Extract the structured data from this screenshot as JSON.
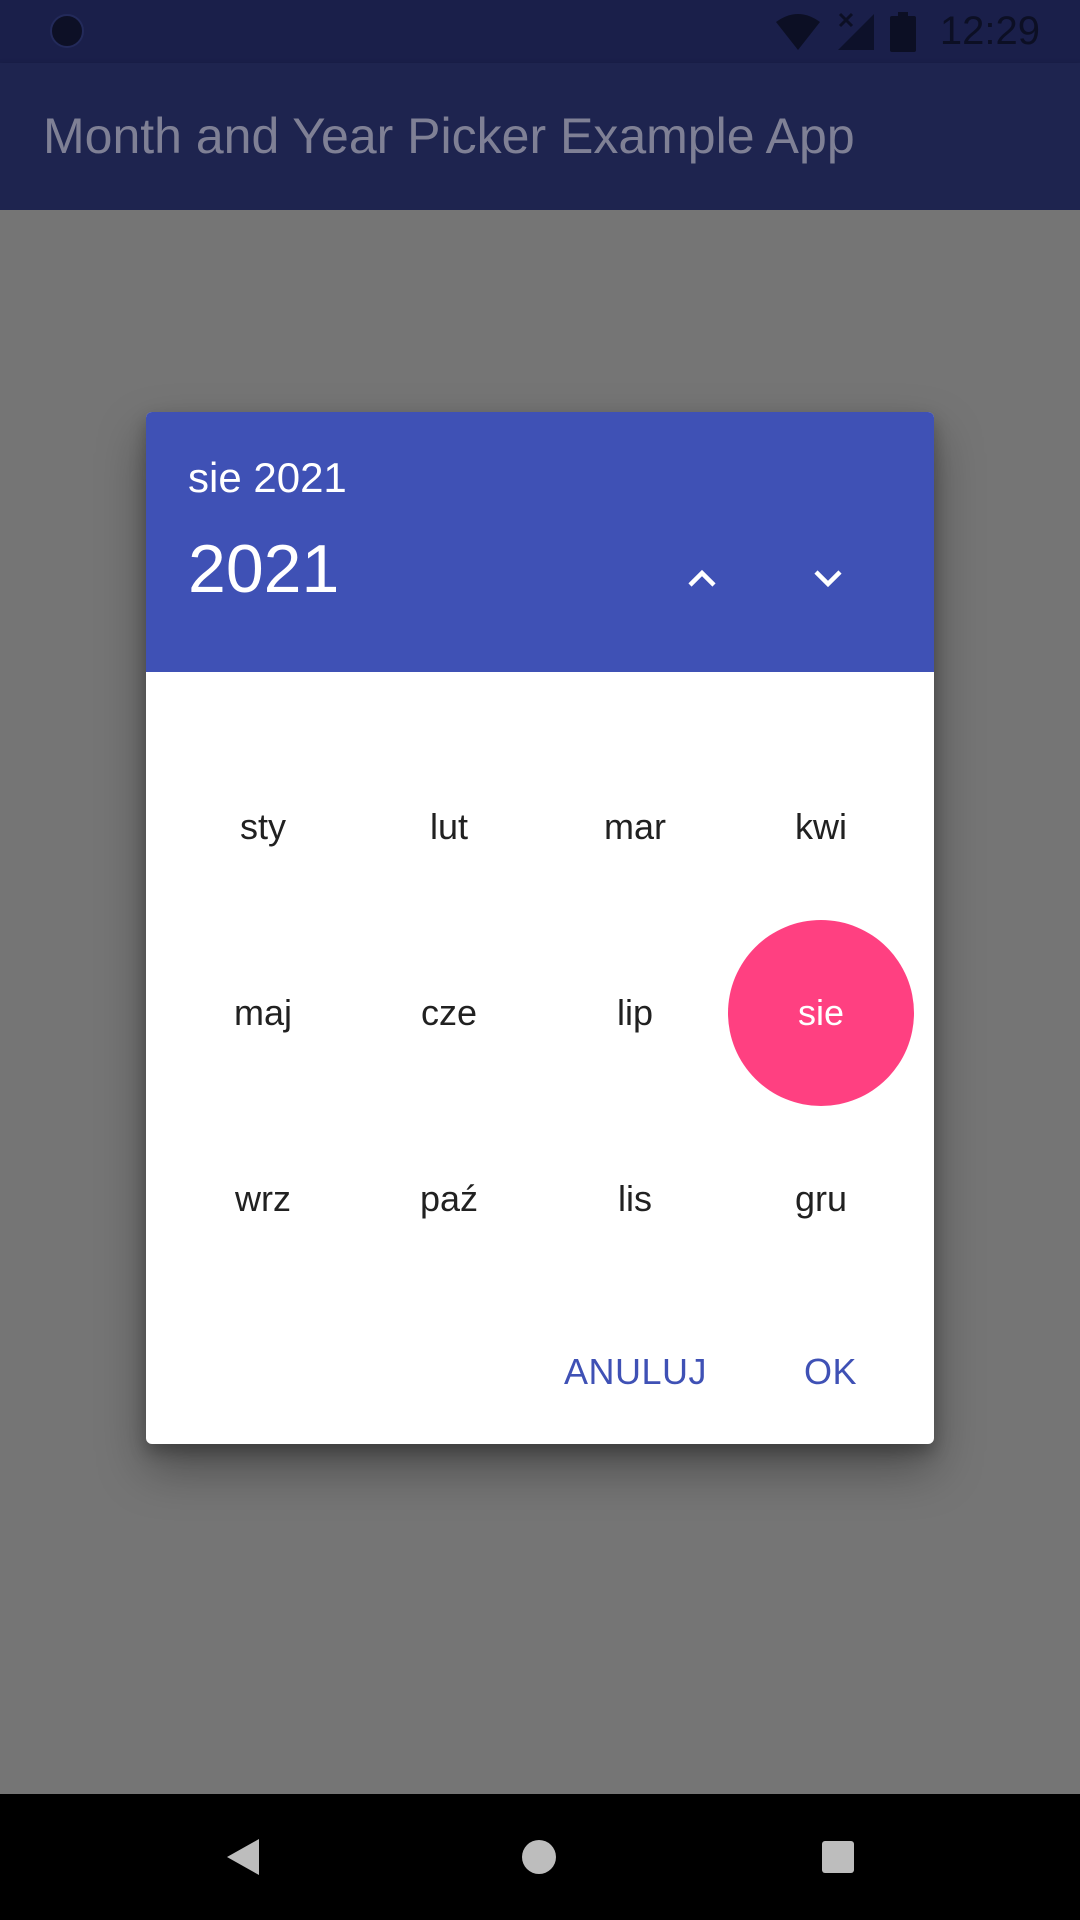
{
  "status_bar": {
    "time": "12:29",
    "icons": [
      "notification-dot-icon",
      "wifi-icon",
      "signal-off-icon",
      "battery-icon"
    ]
  },
  "app_bar": {
    "title": "Month and Year Picker Example App"
  },
  "dialog": {
    "selected_label": "sie 2021",
    "year": "2021",
    "year_up_icon": "chevron-up-icon",
    "year_down_icon": "chevron-down-icon",
    "months": [
      {
        "label": "sty",
        "selected": false
      },
      {
        "label": "lut",
        "selected": false
      },
      {
        "label": "mar",
        "selected": false
      },
      {
        "label": "kwi",
        "selected": false
      },
      {
        "label": "maj",
        "selected": false
      },
      {
        "label": "cze",
        "selected": false
      },
      {
        "label": "lip",
        "selected": false
      },
      {
        "label": "sie",
        "selected": true
      },
      {
        "label": "wrz",
        "selected": false
      },
      {
        "label": "paź",
        "selected": false
      },
      {
        "label": "lis",
        "selected": false
      },
      {
        "label": "gru",
        "selected": false
      }
    ],
    "cancel_label": "ANULUJ",
    "ok_label": "OK"
  },
  "nav_bar": {
    "icons": [
      "back-icon",
      "home-icon",
      "recents-icon"
    ]
  },
  "colors": {
    "primary": "#3f51b5",
    "primary_dark": "#1e244f",
    "accent": "#ff4081",
    "scrim": "#757575"
  }
}
